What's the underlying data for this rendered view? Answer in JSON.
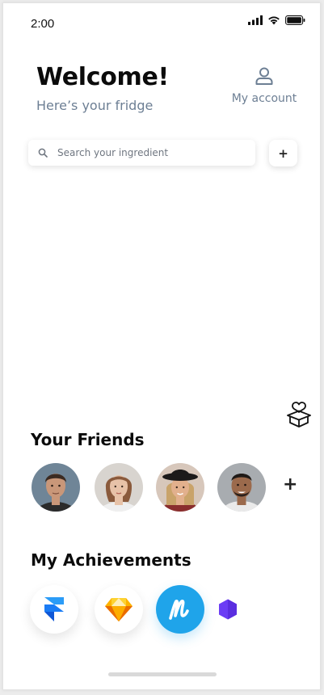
{
  "status_bar": {
    "time": "2:00"
  },
  "header": {
    "title": "Welcome!",
    "subtitle": "Here’s your fridge",
    "account_label": "My account"
  },
  "search": {
    "placeholder": "Search your ingredient",
    "value": ""
  },
  "add_button": {
    "label": "+"
  },
  "friends": {
    "title": "Your Friends",
    "add_label": "+",
    "items": [
      {
        "name": "friend-1",
        "skin": "#c99779",
        "hair": "#3b2b22",
        "bg": "#6f8597",
        "shirt": "#2b2b2b"
      },
      {
        "name": "friend-2",
        "skin": "#e7c2a8",
        "hair": "#8a5a3c",
        "bg": "#d8d4cf",
        "shirt": "#efefef"
      },
      {
        "name": "friend-3",
        "skin": "#e2b08d",
        "hair": "#c9a36a",
        "bg": "#d7c7bb",
        "shirt": "#8a2e2e"
      },
      {
        "name": "friend-4",
        "skin": "#9b6a4c",
        "hair": "#1f1a17",
        "bg": "#a8acb0",
        "shirt": "#eaeaea"
      }
    ]
  },
  "achievements": {
    "title": "My Achievements",
    "items": [
      "framer-icon",
      "sketch-icon",
      "marvel-icon",
      "hexagon-icon"
    ]
  },
  "colors": {
    "subtitle": "#6d7f94",
    "marvel_blue": "#1fa4ea",
    "hexagon_purple": "#6b3df5",
    "framer_blue": "#1a7cf5",
    "sketch_orange": "#f7b500"
  }
}
